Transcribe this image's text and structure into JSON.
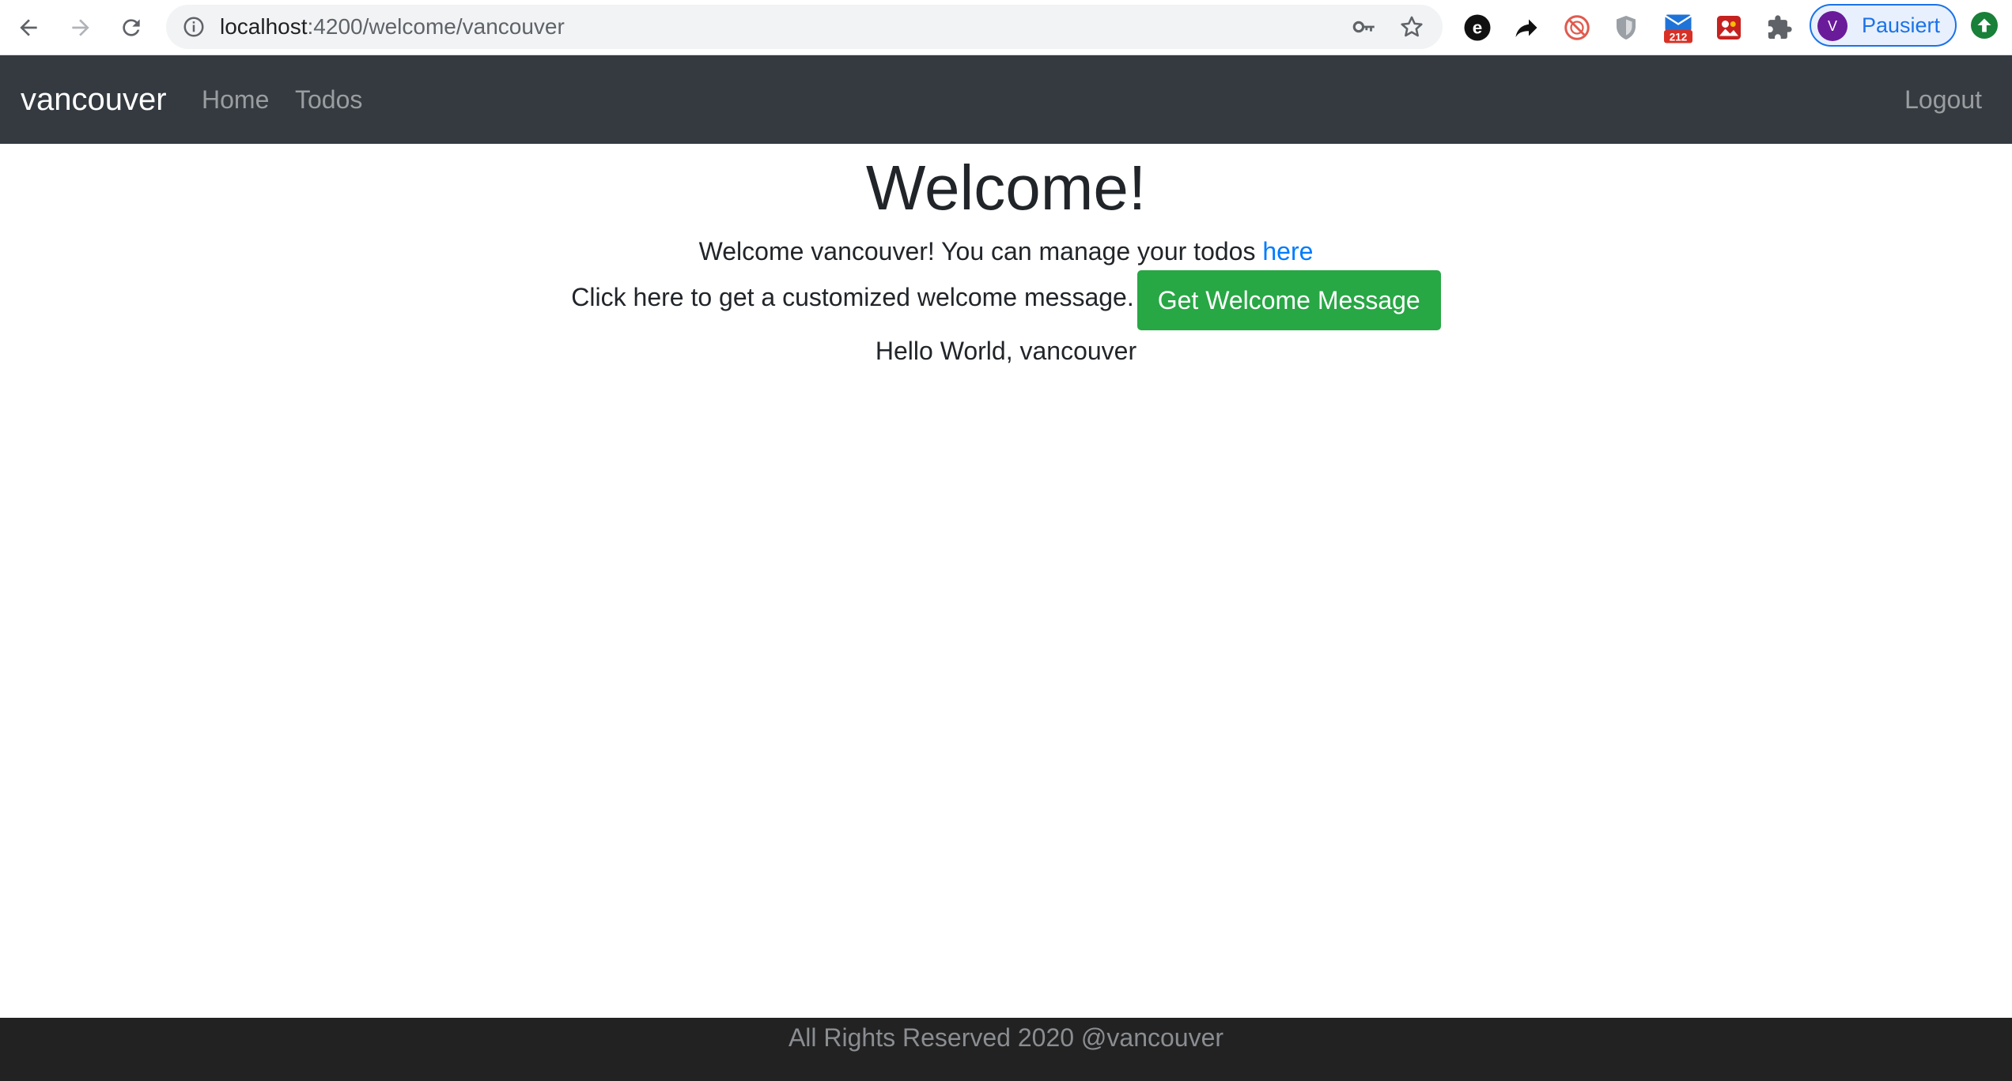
{
  "browser": {
    "url_host": "localhost",
    "url_rest": ":4200/welcome/vancouver",
    "profile_initial": "V",
    "profile_name": "Pausiert",
    "mail_badge": "212"
  },
  "navbar": {
    "brand": "vancouver",
    "links": [
      "Home",
      "Todos"
    ],
    "logout": "Logout"
  },
  "main": {
    "title": "Welcome!",
    "intro_text": "Welcome vancouver! You can manage your todos ",
    "intro_link": "here",
    "cta_text": "Click here to get a customized welcome message.",
    "cta_button": "Get Welcome Message",
    "message": "Hello World, vancouver"
  },
  "footer": {
    "text": "All Rights Reserved 2020 @vancouver"
  },
  "colors": {
    "navbar_bg": "#343a40",
    "footer_bg": "#222222",
    "link": "#007bff",
    "success": "#28a745",
    "profile_accent": "#1a73e8"
  }
}
